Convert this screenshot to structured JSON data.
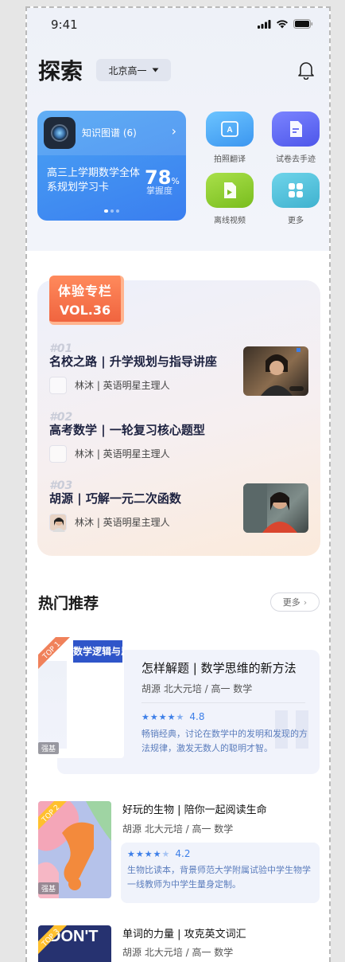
{
  "status": {
    "time": "9:41"
  },
  "header": {
    "title": "探索",
    "region": "北京高一"
  },
  "study_card": {
    "kg_label": "知识图谱 (6)",
    "plan_title": "高三上学期数学全体系规划学习卡",
    "mastery_value": "78",
    "mastery_unit": "%",
    "mastery_label": "掌握度"
  },
  "tools": [
    {
      "label": "拍照翻译",
      "icon": "translate-icon",
      "color": "#4aa8f5"
    },
    {
      "label": "试卷去手迹",
      "icon": "paper-icon",
      "color": "#5b63f0"
    },
    {
      "label": "离线视频",
      "icon": "offline-video-icon",
      "color": "#8dcc2c"
    },
    {
      "label": "更多",
      "icon": "more-grid-icon",
      "color": "#47b9d6"
    }
  ],
  "experience": {
    "badge_line1": "体验专栏",
    "badge_line2": "VOL.36",
    "episodes": [
      {
        "no": "#01",
        "title": "名校之路 | 升学规划与指导讲座",
        "host": "林沐 | 英语明星主理人"
      },
      {
        "no": "#02",
        "title": "高考数学 | 一轮复习核心题型",
        "host": "林沐 | 英语明星主理人"
      },
      {
        "no": "#03",
        "title": "胡源 | 巧解一元二次函数",
        "host": "林沐 | 英语明星主理人"
      }
    ]
  },
  "hot": {
    "title": "热门推荐",
    "more": "更多",
    "items": [
      {
        "rank": "TOP 1",
        "cover_text": "数学逻辑与思维",
        "tag": "强基",
        "title": "怎样解题 | 数学思维的新方法",
        "sub": "胡源 北大元培 / 高一 数学",
        "rating": "4.8",
        "stars": 4.5,
        "desc": "畅销经典，讨论在数学中的发明和发现的方法规律，激发无数人的聪明才智。"
      },
      {
        "rank": "TOP 2",
        "tag": "强基",
        "title": "好玩的生物 | 陪你一起阅读生命",
        "sub": "胡源 北大元培 / 高一 数学",
        "rating": "4.2",
        "stars": 4,
        "desc": "生物比读本，背景师范大学附属试验中学生物学一线教师为中学生量身定制。"
      },
      {
        "rank": "TOP 3",
        "cover_text": "DON'T",
        "title": "单词的力量 | 攻克英文词汇",
        "sub": "胡源 北大元培 / 高一 数学"
      }
    ]
  }
}
